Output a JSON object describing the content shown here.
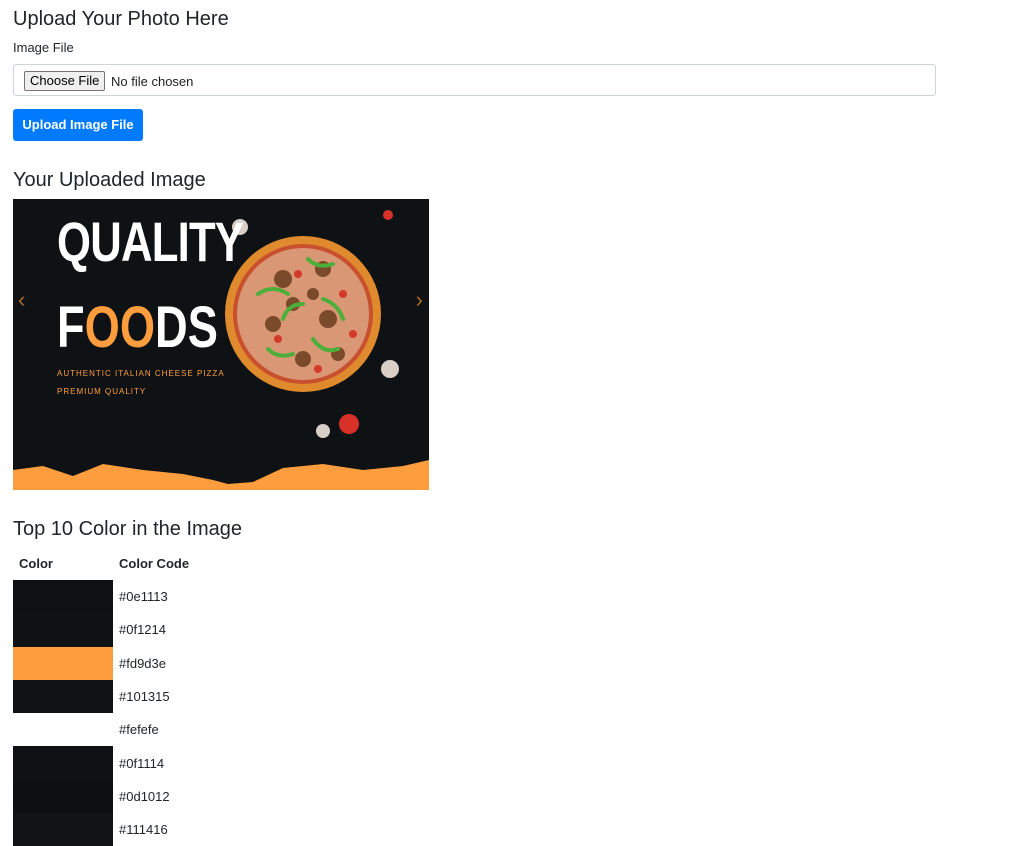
{
  "upload_section": {
    "title": "Upload Your Photo Here",
    "field_label": "Image File",
    "choose_button": "Choose File",
    "no_file_text": "No file chosen",
    "submit_button": "Upload Image File"
  },
  "uploaded_section": {
    "title": "Your Uploaded Image",
    "banner": {
      "line1": "QUALITY",
      "line2_a": "F",
      "line2_b": "OO",
      "line2_c": "DS",
      "tagline1": "AUTHENTIC ITALIAN CHEESE PIZZA",
      "tagline2": "PREMIUM QUALITY",
      "prev_arrow": "‹",
      "next_arrow": "›"
    }
  },
  "colors_section": {
    "title": "Top 10 Color in the Image",
    "headers": [
      "Color",
      "Color Code"
    ],
    "rows": [
      {
        "swatch": "#0e1113",
        "code": "#0e1113"
      },
      {
        "swatch": "#0f1214",
        "code": "#0f1214"
      },
      {
        "swatch": "#fd9d3e",
        "code": "#fd9d3e"
      },
      {
        "swatch": "#101315",
        "code": "#101315"
      },
      {
        "swatch": "#fefefe",
        "code": "#fefefe"
      },
      {
        "swatch": "#0f1114",
        "code": "#0f1114"
      },
      {
        "swatch": "#0d1012",
        "code": "#0d1012"
      },
      {
        "swatch": "#111416",
        "code": "#111416"
      }
    ]
  },
  "colors": {
    "primary_button": "#007bff",
    "accent_orange": "#fd9d3e"
  }
}
